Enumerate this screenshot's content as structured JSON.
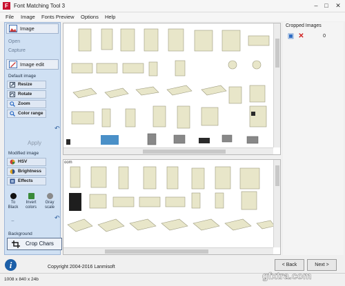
{
  "window": {
    "title": "Font Matching Tool 3"
  },
  "menu": [
    {
      "id": "file",
      "label": "File"
    },
    {
      "id": "image",
      "label": "Image"
    },
    {
      "id": "fonts-preview",
      "label": "Fonts Preview"
    },
    {
      "id": "options",
      "label": "Options"
    },
    {
      "id": "help",
      "label": "Help"
    }
  ],
  "sidebar": {
    "image_header": "Image",
    "open": "Open",
    "capture": "Capture",
    "image_edit_header": "Image edit",
    "default_image_label": "Default image",
    "tools": [
      {
        "id": "resize",
        "label": "Resize",
        "icon": "resize-icon",
        "color": "#3a4a5e"
      },
      {
        "id": "rotate",
        "label": "Rotate",
        "icon": "rotate-icon",
        "color": "#3a4a5e"
      },
      {
        "id": "zoom",
        "label": "Zoom",
        "icon": "zoom-icon",
        "color": "#2d6cc4"
      },
      {
        "id": "color-range",
        "label": "Color range",
        "icon": "color-range-icon",
        "color": "#2d6cc4"
      }
    ],
    "apply": "Apply",
    "modified_image_label": "Modified image",
    "mod_tools": [
      {
        "id": "hsv",
        "label": "HSV",
        "icon": "hsv-icon",
        "color": "#c83c3c"
      },
      {
        "id": "brightness",
        "label": "Brightness",
        "icon": "brightness-icon",
        "color": "#d9a020"
      },
      {
        "id": "effects",
        "label": "Effects",
        "icon": "effects-icon",
        "color": "#2d4f8c"
      }
    ],
    "mini_tools": [
      {
        "id": "to-black",
        "label": "To Black",
        "icon": "to-black-icon",
        "color": "#111111"
      },
      {
        "id": "invert-colors",
        "label": "Invert colors",
        "icon": "invert-colors-icon",
        "color": "#3a8a3a"
      },
      {
        "id": "gray-scale",
        "label": "Gray scale",
        "icon": "gray-scale-icon",
        "color": "#8a8a8a"
      }
    ],
    "background_label": "Background",
    "crop_chars": "Crop Chars"
  },
  "viewer": {
    "zoom_label": "oom"
  },
  "cropped": {
    "title": "Cropped Images",
    "count": "0"
  },
  "footer": {
    "copyright": "Copyright 2004-2016 Lanmisoft",
    "back": "< Back",
    "next": "Next >",
    "status": "1008 x 840 x 24b"
  },
  "watermark": "gfxtra.com",
  "colors": {
    "sidebar_bg": "#cfe0f3",
    "accent": "#2d6cc4",
    "furniture": "#e8e6c9"
  }
}
